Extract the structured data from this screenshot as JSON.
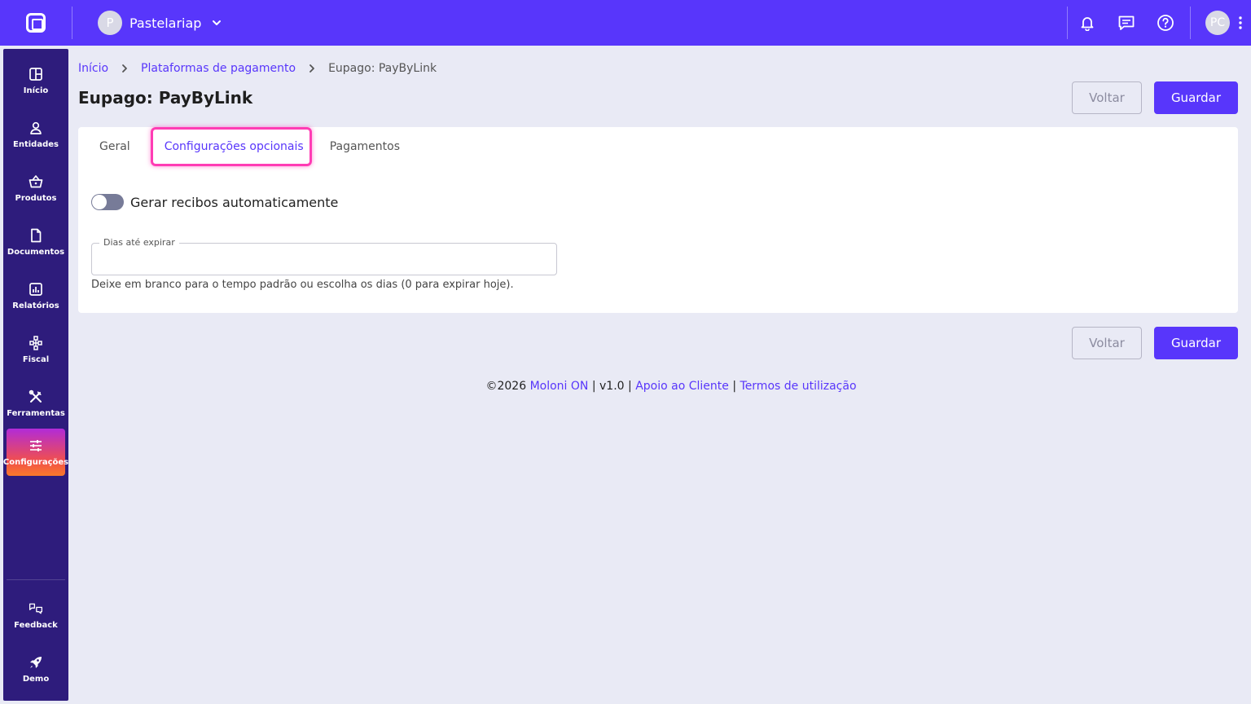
{
  "topbar": {
    "company_initial": "P",
    "company_name": "Pastelariap",
    "user_initials": "PC",
    "icons": [
      "logo-icon",
      "chevron-down-icon",
      "bell-icon",
      "chat-icon",
      "help-icon",
      "more-vertical-icon"
    ]
  },
  "sidebar": {
    "items": [
      {
        "label": "Início",
        "icon": "dashboard-icon"
      },
      {
        "label": "Entidades",
        "icon": "user-icon"
      },
      {
        "label": "Produtos",
        "icon": "basket-icon"
      },
      {
        "label": "Documentos",
        "icon": "document-icon"
      },
      {
        "label": "Relatórios",
        "icon": "chart-icon"
      },
      {
        "label": "Fiscal",
        "icon": "hierarchy-icon"
      },
      {
        "label": "Ferramentas",
        "icon": "tools-icon"
      },
      {
        "label": "Configurações",
        "icon": "sliders-icon",
        "active": true
      }
    ],
    "bottom": [
      {
        "label": "Feedback",
        "icon": "feedback-icon"
      },
      {
        "label": "Demo",
        "icon": "rocket-icon"
      }
    ]
  },
  "breadcrumb": {
    "home": "Início",
    "section": "Plataformas de pagamento",
    "current": "Eupago: PayByLink"
  },
  "page": {
    "title": "Eupago: PayByLink",
    "back_label": "Voltar",
    "save_label": "Guardar"
  },
  "tabs": [
    {
      "label": "Geral"
    },
    {
      "label": "Configurações opcionais",
      "active": true
    },
    {
      "label": "Pagamentos"
    }
  ],
  "form": {
    "toggle_label": "Gerar recibos automaticamente",
    "toggle_on": false,
    "expire_label": "Dias até expirar",
    "expire_value": "",
    "expire_hint": "Deixe em branco para o tempo padrão ou escolha os dias (0 para expirar hoje)."
  },
  "footer": {
    "copyright": "©2026 ",
    "brand": "Moloni ON",
    "sep": " | ",
    "version": "v1.0",
    "support": "Apoio ao Cliente",
    "terms": "Termos de utilização"
  },
  "colors": {
    "primary": "#5836fb",
    "sidebar": "#2e1c7c",
    "highlight": "#ff3cb4",
    "background": "#e9eaf5"
  }
}
